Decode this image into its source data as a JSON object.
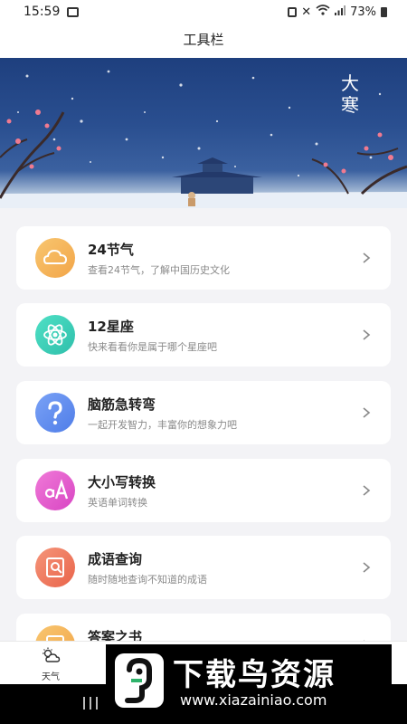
{
  "status_bar": {
    "time": "15:59",
    "battery": "73%",
    "icons": [
      "gallery-icon",
      "sim-icon",
      "mute-icon",
      "wifi-icon",
      "signal-icon",
      "battery-icon"
    ]
  },
  "header": {
    "title": "工具栏"
  },
  "banner": {
    "text": "大寒",
    "image": "snowy-night-palace-illustration"
  },
  "tools": [
    {
      "title": "24节气",
      "subtitle": "查看24节气，了解中国历史文化",
      "icon": "cloud-icon",
      "color": "#f5b55a"
    },
    {
      "title": "12星座",
      "subtitle": "快来看看你是属于哪个星座吧",
      "icon": "atom-icon",
      "color": "#3fd0b9"
    },
    {
      "title": "脑筋急转弯",
      "subtitle": "一起开发智力，丰富你的想象力吧",
      "icon": "question-icon",
      "color": "#5f8cf0"
    },
    {
      "title": "大小写转换",
      "subtitle": "英语单词转换",
      "icon": "letter-case-icon",
      "color": "#e85bd0"
    },
    {
      "title": "成语查询",
      "subtitle": "随时随地查询不知道的成语",
      "icon": "search-book-icon",
      "color": "#f07a5c"
    },
    {
      "title": "答案之书",
      "subtitle": "",
      "icon": "book-icon",
      "color": "#f5b55a"
    }
  ],
  "tabbar": {
    "items": [
      {
        "label": "天气",
        "icon": "weather-icon"
      }
    ]
  },
  "watermark": {
    "title": "下载鸟资源",
    "url": "www.xiazainiao.com"
  }
}
